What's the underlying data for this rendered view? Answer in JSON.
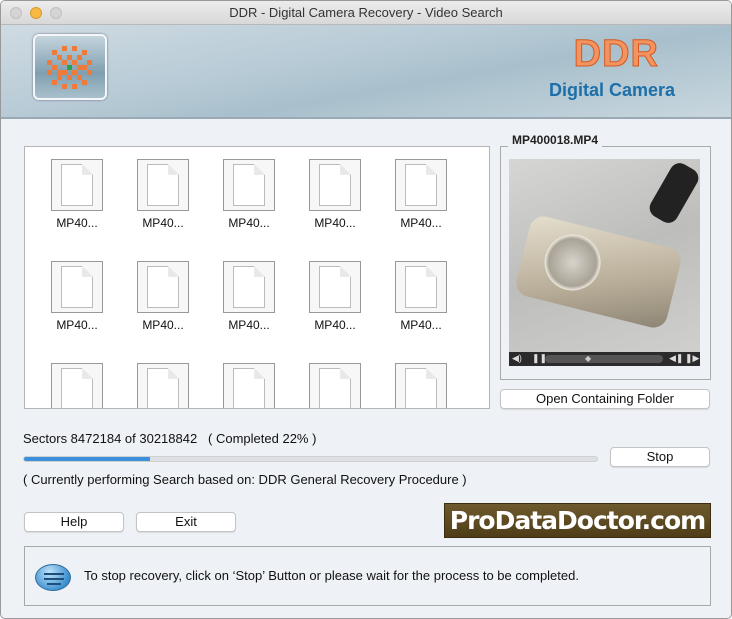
{
  "window": {
    "title": "DDR - Digital Camera Recovery - Video Search"
  },
  "header": {
    "brand": "DDR",
    "subtitle": "Digital Camera"
  },
  "files": [
    "MP40...",
    "MP40...",
    "MP40...",
    "MP40...",
    "MP40...",
    "MP40...",
    "MP40...",
    "MP40...",
    "MP40...",
    "MP40...",
    "",
    "",
    "",
    "",
    ""
  ],
  "preview": {
    "filename": "MP400018.MP4",
    "open_folder_label": "Open Containing Folder"
  },
  "progress": {
    "sectors_text": "Sectors 8472184 of 30218842",
    "completed_text": "( Completed  22% )",
    "percent": 22,
    "status_text": "( Currently performing Search based on: DDR General Recovery Procedure )",
    "stop_label": "Stop"
  },
  "buttons": {
    "help": "Help",
    "exit": "Exit"
  },
  "logo_text": "ProDataDoctor.com",
  "message": "To stop recovery, click on ‘Stop’ Button or please wait for the process to be completed.",
  "colors": {
    "accent": "#3b8fdc",
    "brand_orange": "#f3935f",
    "brand_blue": "#1c6fa8"
  }
}
